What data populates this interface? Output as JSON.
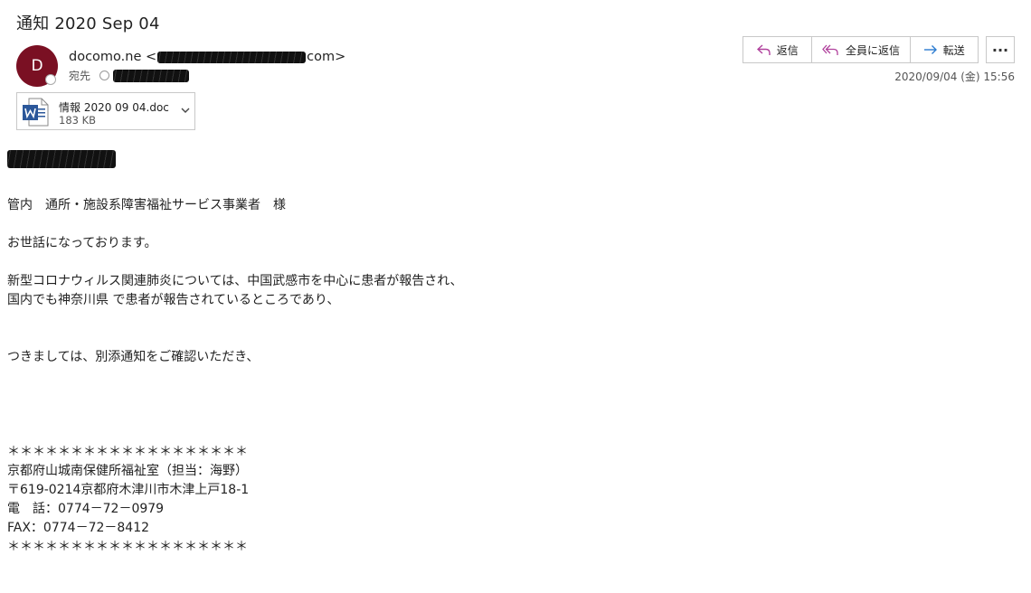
{
  "subject": "通知 2020 Sep 04",
  "sender": {
    "avatar_letter": "D",
    "name_prefix": "docomo.ne <",
    "name_suffix": "com>"
  },
  "to_label": "宛先",
  "actions": {
    "reply": "返信",
    "reply_all": "全員に返信",
    "forward": "転送",
    "more": "···"
  },
  "date": "2020/09/04 (金) 15:56",
  "attachment": {
    "name": "情報 2020 09 04.doc",
    "size": "183 KB"
  },
  "body": {
    "line1": "管内　通所・施設系障害福祉サービス事業者　様",
    "line2": "お世話になっております。",
    "line3": "新型コロナウィルス関連肺炎については、中国武感市を中心に患者が報告され、",
    "line4": "国内でも神奈川県 で患者が報告されているところであり、",
    "line5": "つきましては、別添通知をご確認いただき、",
    "sig_rule1": "＊＊＊＊＊＊＊＊＊＊＊＊＊＊＊＊＊＊＊",
    "sig_org": "京都府山城南保健所福祉室（担当：海野）",
    "sig_addr": "〒619-0214京都府木津川市木津上戸18-1",
    "sig_tel": "電　話：0774－72－0979",
    "sig_fax": "FAX：0774－72－8412",
    "sig_rule2": "＊＊＊＊＊＊＊＊＊＊＊＊＊＊＊＊＊＊＊"
  },
  "colors": {
    "avatar": "#7a1023",
    "reply_icon": "#b0409c",
    "forward_icon": "#2b7bd0",
    "word_icon": "#2b579a"
  }
}
